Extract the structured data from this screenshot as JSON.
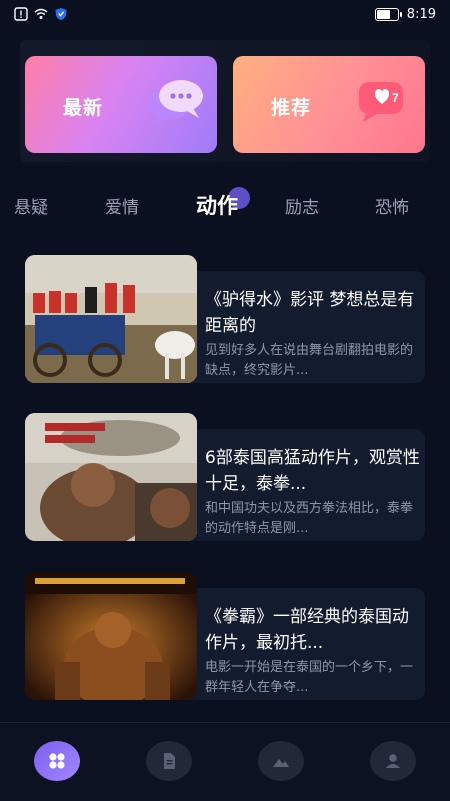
{
  "status_bar": {
    "time": "8:19"
  },
  "top_cards": {
    "new": {
      "label": "最新"
    },
    "recommend": {
      "label": "推荐",
      "badge": "7"
    }
  },
  "tabs": [
    {
      "label": "悬疑"
    },
    {
      "label": "爱情"
    },
    {
      "label": "动作",
      "active": true
    },
    {
      "label": "励志"
    },
    {
      "label": "恐怖"
    }
  ],
  "articles": [
    {
      "title": "《驴得水》影评 梦想总是有距离的",
      "desc": "见到好多人在说由舞台剧翻拍电影的缺点，终究影片..."
    },
    {
      "title": "6部泰国高猛动作片，观赏性十足，泰拳...",
      "desc": "和中国功夫以及西方拳法相比，泰拳的动作特点是刚..."
    },
    {
      "title": "《拳霸》一部经典的泰国动作片，最初托...",
      "desc": "电影一开始是在泰国的一个乡下，一群年轻人在争夺..."
    }
  ],
  "bottom_nav": [
    {
      "icon": "grid-icon",
      "active": true
    },
    {
      "icon": "document-icon"
    },
    {
      "icon": "image-icon"
    },
    {
      "icon": "user-icon"
    }
  ],
  "colors": {
    "background": "#0b1020",
    "accent": "#8b6cf5",
    "card_bg": "#131b2e"
  }
}
